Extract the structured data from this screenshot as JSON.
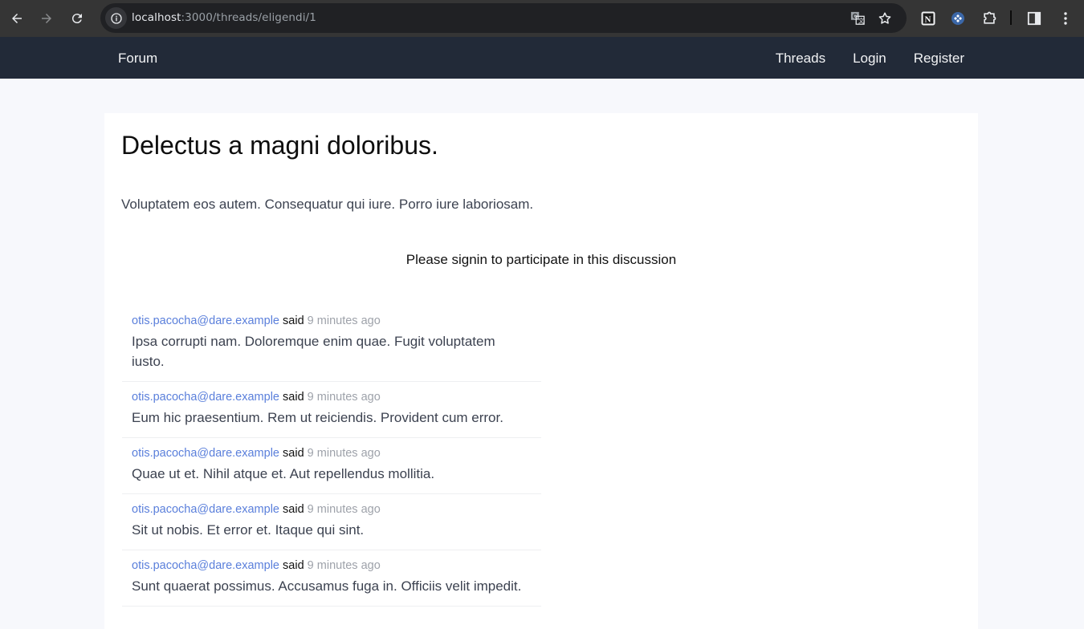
{
  "browser": {
    "url_host": "localhost",
    "url_rest": ":3000/threads/eligendi/1",
    "icons": [
      "back-icon",
      "forward-icon",
      "reload-icon",
      "site-info-icon",
      "translate-icon",
      "bookmark-star-icon",
      "notion-extension-icon",
      "blue-extension-icon",
      "extensions-puzzle-icon",
      "side-panel-icon",
      "more-menu-icon"
    ]
  },
  "navbar": {
    "brand": "Forum",
    "links": [
      {
        "label": "Threads"
      },
      {
        "label": "Login"
      },
      {
        "label": "Register"
      }
    ]
  },
  "thread": {
    "title": "Delectus a magni doloribus.",
    "body": "Voluptatem eos autem. Consequatur qui iure. Porro iure laboriosam.",
    "signin_notice": "Please signin to participate in this discussion"
  },
  "replies": [
    {
      "author": "otis.pacocha@dare.example",
      "said": "said",
      "time": "9 minutes ago",
      "body": "Ipsa corrupti nam. Doloremque enim quae. Fugit voluptatem iusto."
    },
    {
      "author": "otis.pacocha@dare.example",
      "said": "said",
      "time": "9 minutes ago",
      "body": "Eum hic praesentium. Rem ut reiciendis. Provident cum error."
    },
    {
      "author": "otis.pacocha@dare.example",
      "said": "said",
      "time": "9 minutes ago",
      "body": "Quae ut et. Nihil atque et. Aut repellendus mollitia."
    },
    {
      "author": "otis.pacocha@dare.example",
      "said": "said",
      "time": "9 minutes ago",
      "body": "Sit ut nobis. Et error et. Itaque qui sint."
    },
    {
      "author": "otis.pacocha@dare.example",
      "said": "said",
      "time": "9 minutes ago",
      "body": "Sunt quaerat possimus. Accusamus fuga in. Officiis velit impedit."
    }
  ],
  "colors": {
    "navbar_bg": "#222a38",
    "page_bg": "#f7f8fc",
    "author_link": "#5a7fdb",
    "timestamp": "#9ea2aa"
  }
}
